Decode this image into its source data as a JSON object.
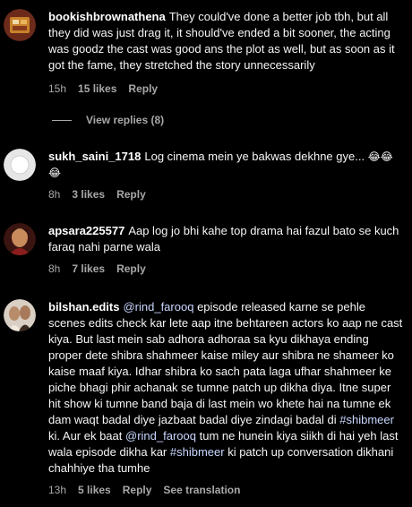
{
  "comments": [
    {
      "username": "bookishbrownathena",
      "text": "They could've done a better job tbh, but all they did was just drag it, it should've ended a bit sooner, the acting was goodz the cast was good ans the plot as well, but as soon as it got the fame, they stretched the story unnecessarily",
      "time": "15h",
      "likes": "15 likes",
      "reply": "Reply",
      "view_replies": "View replies (8)"
    },
    {
      "username": "sukh_saini_1718",
      "text": "Log cinema mein ye bakwas dekhne gye...",
      "emoji": "😂😂😂",
      "time": "8h",
      "likes": "3 likes",
      "reply": "Reply"
    },
    {
      "username": "apsara225577",
      "text": "Aap log jo bhi kahe top drama hai fazul bato se kuch faraq nahi parne wala",
      "time": "8h",
      "likes": "7 likes",
      "reply": "Reply"
    },
    {
      "username": "bilshan.edits",
      "mention1": "@rind_farooq",
      "text_a": "episode released karne se pehle scenes edits check kar lete aap itne behtareen actors ko aap ne cast kiya. But last mein sab adhora adhoraa sa kyu dikhaya ending proper dete shibra shahmeer kaise miley aur shibra ne shameer ko kaise maaf kiya. Idhar shibra ko sach pata laga ufhar shahmeer ke piche bhagi phir achanak se tumne patch up dikha diya. Itne super hit show ki tumne band baja di last mein wo khete hai na tumne ek dam waqt badal diye jazbaat badal diye zindagi badal di",
      "hashtag1": "#shibmeer",
      "text_b": "ki. Aur ek baat",
      "mention2": "@rind_farooq",
      "text_c": "tum ne hunein kiya siikh di hai yeh last wala episode dikha kar",
      "hashtag2": "#shibmeer",
      "text_d": "ki patch up conversation dikhani chahhiye tha tumhe",
      "time": "13h",
      "likes": "5 likes",
      "reply": "Reply",
      "translation": "See translation"
    }
  ]
}
